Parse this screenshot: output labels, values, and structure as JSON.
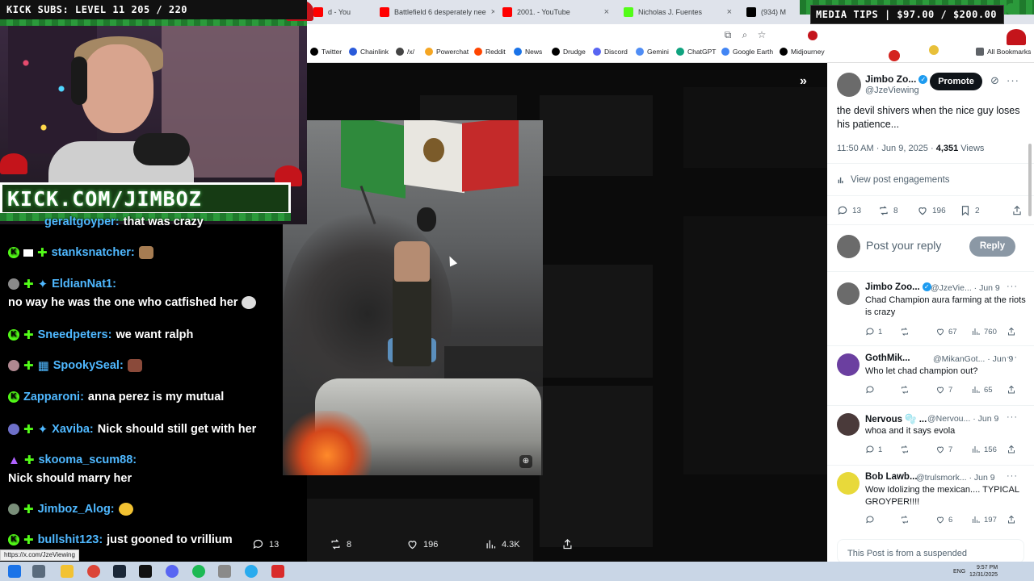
{
  "browser": {
    "tabs": [
      {
        "label": "d - You",
        "color": "#ff0000"
      },
      {
        "label": "Battlefield 6 desperately nee",
        "color": "#ff0000"
      },
      {
        "label": "2001. - YouTube",
        "color": "#ff0000"
      },
      {
        "label": "Nicholas J. Fuentes",
        "color": "#53fc18"
      },
      {
        "label": "(934) M",
        "color": "#000000"
      }
    ],
    "bookmarks": [
      {
        "label": "Twitter",
        "color": "#000000"
      },
      {
        "label": "Chainlink",
        "color": "#2a5ada"
      },
      {
        "label": "/x/",
        "color": "#444444"
      },
      {
        "label": "Powerchat",
        "color": "#f5a623"
      },
      {
        "label": "Reddit",
        "color": "#ff4500"
      },
      {
        "label": "News",
        "color": "#1a73e8"
      },
      {
        "label": "Drudge",
        "color": "#000000"
      },
      {
        "label": "Discord",
        "color": "#5865f2"
      },
      {
        "label": "Gemini",
        "color": "#4f8df5"
      },
      {
        "label": "ChatGPT",
        "color": "#10a37f"
      },
      {
        "label": "Google Earth",
        "color": "#4285f4"
      },
      {
        "label": "Midjourney",
        "color": "#000000"
      },
      {
        "label": "All Bookmarks",
        "color": "#5f6368"
      }
    ]
  },
  "overlay": {
    "subs_banner": "KICK SUBS: LEVEL 11 205 / 220",
    "kick_banner": "KICK.COM/JIMBOZ",
    "media_tips": "MEDIA TIPS | $97.00 / $200.00"
  },
  "chat": [
    {
      "user": "geraltgoyper:",
      "msg": "that was crazy",
      "color": "cyan",
      "icons": 0
    },
    {
      "user": "stanksnatcher:",
      "msg": "",
      "color": "cyan",
      "icons": 3,
      "emote": true
    },
    {
      "user": "EldianNat1:",
      "msg": "",
      "color": "cyan",
      "icons": 3
    },
    {
      "user": "",
      "msg": "no way he was the one who catfished her",
      "color": "cyan",
      "icons": 0
    },
    {
      "user": "Sneedpeters:",
      "msg": "we want ralph",
      "color": "cyan",
      "icons": 2
    },
    {
      "user": "SpookySeal:",
      "msg": "",
      "color": "cyan",
      "icons": 3,
      "emote": true
    },
    {
      "user": "Zapparoni:",
      "msg": "anna perez is my mutual",
      "color": "cyan",
      "icons": 1
    },
    {
      "user": "Xaviba:",
      "msg": "Nick should still get with her",
      "color": "cyan",
      "icons": 3
    },
    {
      "user": "skooma_scum88:",
      "msg": "",
      "color": "cyan",
      "icons": 2
    },
    {
      "user": "",
      "msg": "Nick should marry her",
      "color": "cyan",
      "icons": 0
    },
    {
      "user": "Jimboz_Alog:",
      "msg": "",
      "color": "cyan",
      "icons": 2,
      "emote": true
    },
    {
      "user": "bullshit123:",
      "msg": "just gooned to vrillium",
      "color": "cyan",
      "icons": 1
    }
  ],
  "media": {
    "actions": {
      "replies": "13",
      "reposts": "8",
      "likes": "196",
      "views": "4.3K"
    }
  },
  "post": {
    "author_name": "Jimbo Zo...",
    "author_handle": "@JzeViewing",
    "promote_label": "Promote",
    "text": "the devil shivers when the nice guy loses his patience...",
    "time": "11:50 AM · Jun 9, 2025 · ",
    "views_count": "4,351",
    "views_label": " Views",
    "engagements_label": "View post engagements",
    "stats": {
      "replies": "13",
      "reposts": "8",
      "likes": "196",
      "bookmarks": "2"
    },
    "reply_placeholder": "Post your reply",
    "reply_button": "Reply"
  },
  "replies": [
    {
      "name": "Jimbo Zoo...",
      "handle": "@JzeVie...",
      "date": "· Jun 9",
      "text": "Chad Champion aura farming at the riots is crazy",
      "replies": "1",
      "reposts": "",
      "likes": "67",
      "views": "760",
      "avatar": "#6b6b6b",
      "verified": true
    },
    {
      "name": "GothMik...",
      "handle": "@MikanGot...",
      "date": "· Jun 9",
      "text": "Who let chad champion out?",
      "replies": "",
      "reposts": "",
      "likes": "7",
      "views": "65",
      "avatar": "#6b3fa0",
      "verified": false
    },
    {
      "name": "Nervous 🫧 ...",
      "handle": "@Nervou...",
      "date": "· Jun 9",
      "text": "whoa and it says evola",
      "replies": "1",
      "reposts": "",
      "likes": "7",
      "views": "156",
      "avatar": "#4a3a3a",
      "verified": false
    },
    {
      "name": "Bob Lawb...",
      "handle": "@trulsmork...",
      "date": "· Jun 9",
      "text": "Wow Idolizing the mexican.... TYPICAL GROYPER!!!!",
      "replies": "",
      "reposts": "",
      "likes": "6",
      "views": "197",
      "avatar": "#e8d93a",
      "verified": false
    }
  ],
  "suspended_notice": "This Post is from a suspended",
  "status_url": "https://x.com/JzeViewing",
  "tray": {
    "time": "9:57 PM",
    "date": "12/31/2025",
    "lang": "ENG"
  }
}
